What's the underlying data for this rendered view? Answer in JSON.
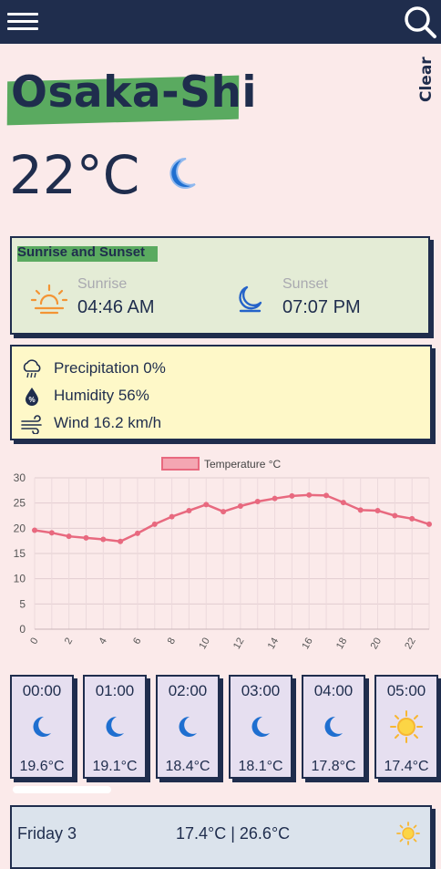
{
  "city": "Osaka-Shi",
  "condition": "Clear",
  "current_temp": "22°C",
  "sun": {
    "title": "Sunrise and Sunset",
    "sunrise_label": "Sunrise",
    "sunrise_time": "04:46 AM",
    "sunset_label": "Sunset",
    "sunset_time": "07:07 PM"
  },
  "details": {
    "precipitation": "Precipitation 0%",
    "humidity": "Humidity 56%",
    "wind": "Wind 16.2 km/h"
  },
  "chart_data": {
    "type": "line",
    "legend": "Temperature °C",
    "x": [
      0,
      1,
      2,
      3,
      4,
      5,
      6,
      7,
      8,
      9,
      10,
      11,
      12,
      13,
      14,
      15,
      16,
      17,
      18,
      19,
      20,
      21,
      22,
      23
    ],
    "values": [
      19.6,
      19.1,
      18.4,
      18.1,
      17.8,
      17.4,
      19.0,
      20.8,
      22.3,
      23.5,
      24.7,
      23.3,
      24.4,
      25.3,
      25.9,
      26.4,
      26.6,
      26.5,
      25.1,
      23.6,
      23.5,
      22.5,
      21.9,
      20.8
    ],
    "ylim": [
      0,
      30
    ],
    "yticks": [
      0,
      5,
      10,
      15,
      20,
      25,
      30
    ],
    "xticks": [
      0,
      2,
      4,
      6,
      8,
      10,
      12,
      14,
      16,
      18,
      20,
      22
    ],
    "color": "#e8697f"
  },
  "hourly": [
    {
      "time": "00:00",
      "icon": "moon-icon",
      "temp": "19.6°C"
    },
    {
      "time": "01:00",
      "icon": "moon-icon",
      "temp": "19.1°C"
    },
    {
      "time": "02:00",
      "icon": "moon-icon",
      "temp": "18.4°C"
    },
    {
      "time": "03:00",
      "icon": "moon-icon",
      "temp": "18.1°C"
    },
    {
      "time": "04:00",
      "icon": "moon-icon",
      "temp": "17.8°C"
    },
    {
      "time": "05:00",
      "icon": "sun-icon",
      "temp": "17.4°C"
    }
  ],
  "daily": [
    {
      "day": "Friday 3",
      "temps": "17.4°C | 26.6°C",
      "icon": "sun-icon"
    }
  ],
  "colors": {
    "navy": "#1f2d4d",
    "highlight": "#5aaa60",
    "background": "#fbeaea"
  }
}
